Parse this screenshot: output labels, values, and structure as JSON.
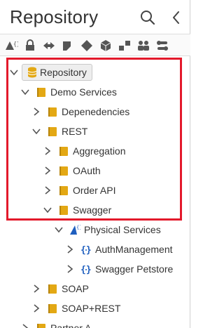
{
  "panel": {
    "title": "Repository",
    "header_icons": [
      "search-icon",
      "collapse-icon"
    ]
  },
  "toolbar": {
    "icons": [
      "rest-api-icon",
      "lock-icon",
      "transfer-icon",
      "connector-icon",
      "diamond-icon",
      "cube-icon",
      "blocks-icon",
      "users-icon",
      "toggle-nodes-icon"
    ]
  },
  "tree": {
    "root": "Repository",
    "demo_services": "Demo Services",
    "dependencies": "Depenedencies",
    "rest": "REST",
    "aggregation": "Aggregation",
    "oauth": "OAuth",
    "order_api": "Order API",
    "swagger": "Swagger",
    "physical_services": "Physical Services",
    "auth_management": "AuthManagement",
    "swagger_petstore": "Swagger Petstore",
    "soap": "SOAP",
    "soap_rest": "SOAP+REST",
    "partner_a": "Partner A"
  },
  "colors": {
    "folder": "#e3a814",
    "highlight": "#e3192b",
    "service_blue": "#1f5fbf",
    "icon_gray": "#555555"
  }
}
